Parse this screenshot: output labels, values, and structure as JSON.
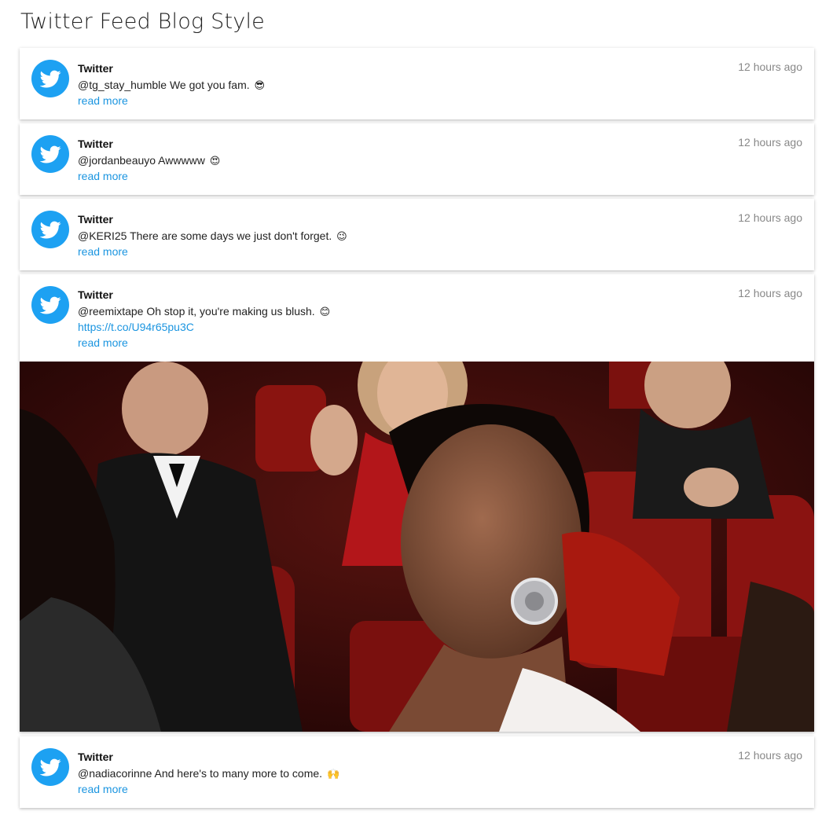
{
  "page": {
    "title": "Twitter Feed Blog Style"
  },
  "colors": {
    "twitter_blue": "#1da1f2",
    "link": "#1b95e0",
    "timestamp": "#888888"
  },
  "icons": {
    "avatar": "twitter-bird-icon"
  },
  "posts": [
    {
      "author": "Twitter",
      "time": "12 hours ago",
      "text": "@tg_stay_humble We got you fam.",
      "emoji": "😎",
      "read_more": "read more"
    },
    {
      "author": "Twitter",
      "time": "12 hours ago",
      "text": "@jordanbeauyo Awwwww",
      "emoji": "😍",
      "read_more": "read more"
    },
    {
      "author": "Twitter",
      "time": "12 hours ago",
      "text": "@KERI25 There are some days we just don't forget.",
      "emoji": "😉",
      "read_more": "read more"
    },
    {
      "author": "Twitter",
      "time": "12 hours ago",
      "text": "@reemixtape Oh stop it, you're making us blush.",
      "emoji": "😊",
      "url": "https://t.co/U94r65pu3C",
      "read_more": "read more"
    },
    {
      "author": "Twitter",
      "time": "12 hours ago",
      "text": "@nadiacorinne And here's to many more to come.",
      "emoji": "🙌",
      "read_more": "read more"
    }
  ]
}
